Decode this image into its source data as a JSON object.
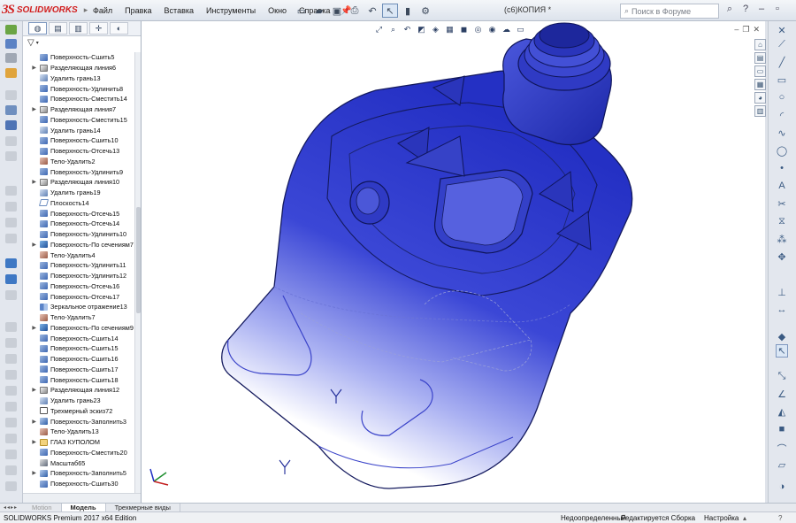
{
  "app": {
    "logo_ds": "3S",
    "logo_name": "SOLIDWORKS",
    "document_title": "(с6)КОПИЯ *"
  },
  "menu": [
    "Файл",
    "Правка",
    "Вставка",
    "Инструменты",
    "Окно",
    "Справка"
  ],
  "search": {
    "placeholder": "Поиск в Форуме"
  },
  "feature_tree": [
    {
      "label": "Поверхность-Сшить5",
      "icon": "surface",
      "expand": false
    },
    {
      "label": "Разделяющая линия6",
      "icon": "split",
      "expand": true
    },
    {
      "label": "Удалить грань13",
      "icon": "delete-face",
      "expand": false
    },
    {
      "label": "Поверхность-Удлинить8",
      "icon": "surface",
      "expand": false
    },
    {
      "label": "Поверхность-Сместить14",
      "icon": "surface",
      "expand": false
    },
    {
      "label": "Разделяющая линия7",
      "icon": "split",
      "expand": true
    },
    {
      "label": "Поверхность-Сместить15",
      "icon": "surface",
      "expand": false
    },
    {
      "label": "Удалить грань14",
      "icon": "delete-face",
      "expand": false
    },
    {
      "label": "Поверхность-Сшить10",
      "icon": "surface",
      "expand": false
    },
    {
      "label": "Поверхность-Отсечь13",
      "icon": "surface",
      "expand": false
    },
    {
      "label": "Тело-Удалить2",
      "icon": "body",
      "expand": false
    },
    {
      "label": "Поверхность-Удлинить9",
      "icon": "surface",
      "expand": false
    },
    {
      "label": "Разделяющая линия10",
      "icon": "split",
      "expand": true
    },
    {
      "label": "Удалить грань19",
      "icon": "delete-face",
      "expand": false
    },
    {
      "label": "Плоскость14",
      "icon": "plane",
      "expand": false
    },
    {
      "label": "Поверхность-Отсечь15",
      "icon": "surface",
      "expand": false
    },
    {
      "label": "Поверхность-Отсечь14",
      "icon": "surface",
      "expand": false
    },
    {
      "label": "Поверхность-Удлинить10",
      "icon": "surface",
      "expand": false
    },
    {
      "label": "Поверхность-По сечениям7",
      "icon": "loft",
      "expand": true
    },
    {
      "label": "Тело-Удалить4",
      "icon": "body",
      "expand": false
    },
    {
      "label": "Поверхность-Удлинить11",
      "icon": "surface",
      "expand": false
    },
    {
      "label": "Поверхность-Удлинить12",
      "icon": "surface",
      "expand": false
    },
    {
      "label": "Поверхность-Отсечь16",
      "icon": "surface",
      "expand": false
    },
    {
      "label": "Поверхность-Отсечь17",
      "icon": "surface",
      "expand": false
    },
    {
      "label": "Зеркальное отражение13",
      "icon": "mirror",
      "expand": false
    },
    {
      "label": "Тело-Удалить7",
      "icon": "body",
      "expand": false
    },
    {
      "label": "Поверхность-По сечениям9",
      "icon": "loft",
      "expand": true
    },
    {
      "label": "Поверхность-Сшить14",
      "icon": "surface",
      "expand": false
    },
    {
      "label": "Поверхность-Сшить15",
      "icon": "surface",
      "expand": false
    },
    {
      "label": "Поверхность-Сшить16",
      "icon": "surface",
      "expand": false
    },
    {
      "label": "Поверхность-Сшить17",
      "icon": "surface",
      "expand": false
    },
    {
      "label": "Поверхность-Сшить18",
      "icon": "surface",
      "expand": false
    },
    {
      "label": "Разделяющая линия12",
      "icon": "split",
      "expand": true
    },
    {
      "label": "Удалить грань23",
      "icon": "delete-face",
      "expand": false
    },
    {
      "label": "Трехмерный эскиз72",
      "icon": "sketch",
      "expand": false
    },
    {
      "label": "Поверхность-Заполнить3",
      "icon": "fill",
      "expand": true
    },
    {
      "label": "Тело-Удалить13",
      "icon": "body",
      "expand": false
    },
    {
      "label": "ГЛАЗ КУПОЛОМ",
      "icon": "folder",
      "expand": true
    },
    {
      "label": "Поверхность-Сместить20",
      "icon": "surface",
      "expand": false
    },
    {
      "label": "Масштаб65",
      "icon": "scale",
      "expand": false
    },
    {
      "label": "Поверхность-Заполнить5",
      "icon": "fill",
      "expand": true
    },
    {
      "label": "Поверхность-Сшить30",
      "icon": "surface",
      "expand": false
    }
  ],
  "bottom_tabs": {
    "hidden": "Motion",
    "model": "Модель",
    "views3d": "Трехмерные виды"
  },
  "status": {
    "edition": "SOLIDWORKS Premium 2017 x64 Edition",
    "definition": "Недоопределенный",
    "editing": "Редактируется Сборка",
    "settings": "Настройка"
  },
  "colors": {
    "model_blue": "#2b35c8",
    "model_light": "#9ea6f0",
    "edge": "#141a5e",
    "logo_red": "#d21f1f"
  }
}
